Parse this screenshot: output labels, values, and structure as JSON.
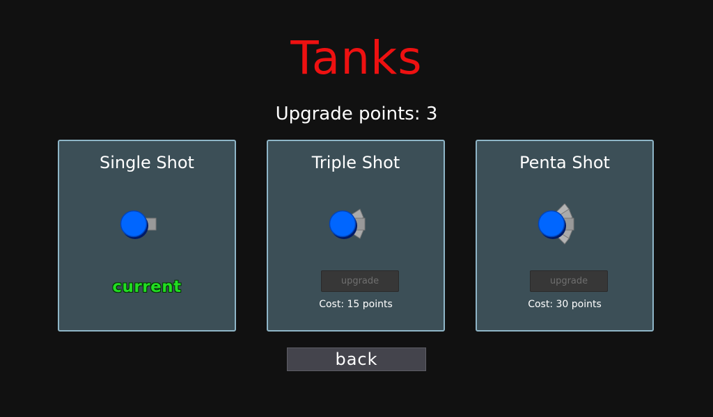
{
  "title": "Tanks",
  "upgrade_points_text": "Upgrade points: 3",
  "cards": [
    {
      "name": "Single Shot",
      "status": "current",
      "icon": "single-shot-tank-icon"
    },
    {
      "name": "Triple Shot",
      "button_label": "upgrade",
      "cost_text": "Cost: 15 points",
      "icon": "triple-shot-tank-icon"
    },
    {
      "name": "Penta Shot",
      "button_label": "upgrade",
      "cost_text": "Cost: 30 points",
      "icon": "penta-shot-tank-icon"
    }
  ],
  "back_label": "back",
  "colors": {
    "background": "#111111",
    "title": "#ee1111",
    "card": "#3c4f57",
    "card_border": "#8fb6c8",
    "tank_body": "#0066ff",
    "tank_barrel": "#999999",
    "current": "#22dd22"
  }
}
